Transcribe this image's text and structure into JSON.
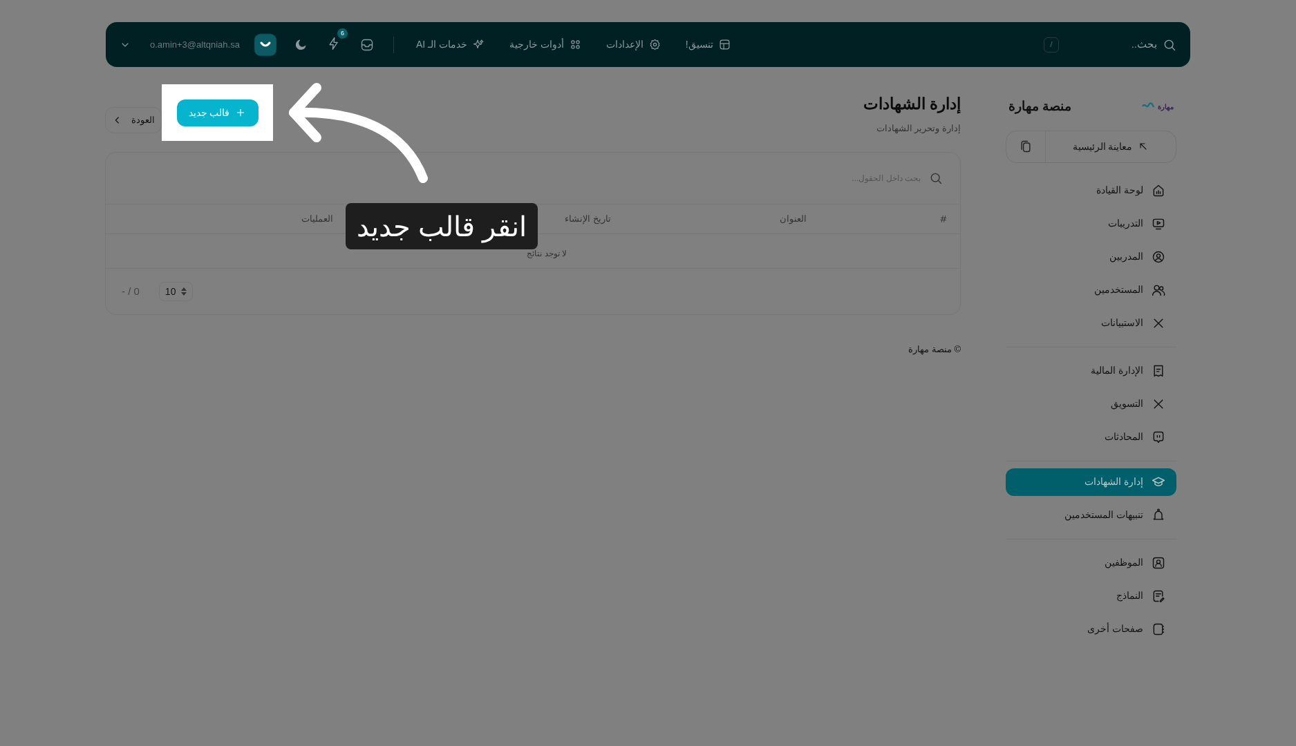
{
  "topbar": {
    "search": {
      "placeholder": "بحث..",
      "shortcut": "/"
    },
    "nav": [
      {
        "label": "تنسيق!"
      },
      {
        "label": "الإعدادات"
      },
      {
        "label": "أدوات خارجية"
      },
      {
        "label": "خدمات الـ AI"
      }
    ],
    "notification_count": "6",
    "user_email": "o.amin+3@altqniah.sa"
  },
  "sidebar": {
    "logo_text": "مهارة",
    "brand": "منصة مهارة",
    "preview_button": "معاينة الرئيسية",
    "groups": [
      [
        {
          "label": "لوحة القيادة",
          "selected": false
        },
        {
          "label": "التدريبات",
          "selected": false
        },
        {
          "label": "المدربين",
          "selected": false
        },
        {
          "label": "المستخدمين",
          "selected": false
        },
        {
          "label": "الاستبيانات",
          "selected": false
        }
      ],
      [
        {
          "label": "الإدارة المالية",
          "selected": false
        },
        {
          "label": "التسويق",
          "selected": false
        },
        {
          "label": "المحادثات",
          "selected": false
        }
      ],
      [
        {
          "label": "إدارة الشهادات",
          "selected": true
        },
        {
          "label": "تنبيهات المستخدمين",
          "selected": false
        }
      ],
      [
        {
          "label": "الموظفين",
          "selected": false
        },
        {
          "label": "النماذج",
          "selected": false
        },
        {
          "label": "صفحات أخرى",
          "selected": false
        }
      ]
    ]
  },
  "page": {
    "title": "إدارة الشهادات",
    "subtitle": "إدارة وتحرير الشهادات",
    "back_button": "العودة",
    "new_button": "قالب جديد",
    "table": {
      "search_placeholder": "بحث داخل الحقول...",
      "columns": [
        "#",
        "العنوان",
        "تاريخ الإنشاء",
        "العمليات"
      ],
      "empty_message": "لا توجد نتائج",
      "page_size": "10",
      "pagination": "- / 0"
    },
    "footer": "© منصة مهارة"
  },
  "tutorial": {
    "callout": "انقر قالب جديد"
  }
}
